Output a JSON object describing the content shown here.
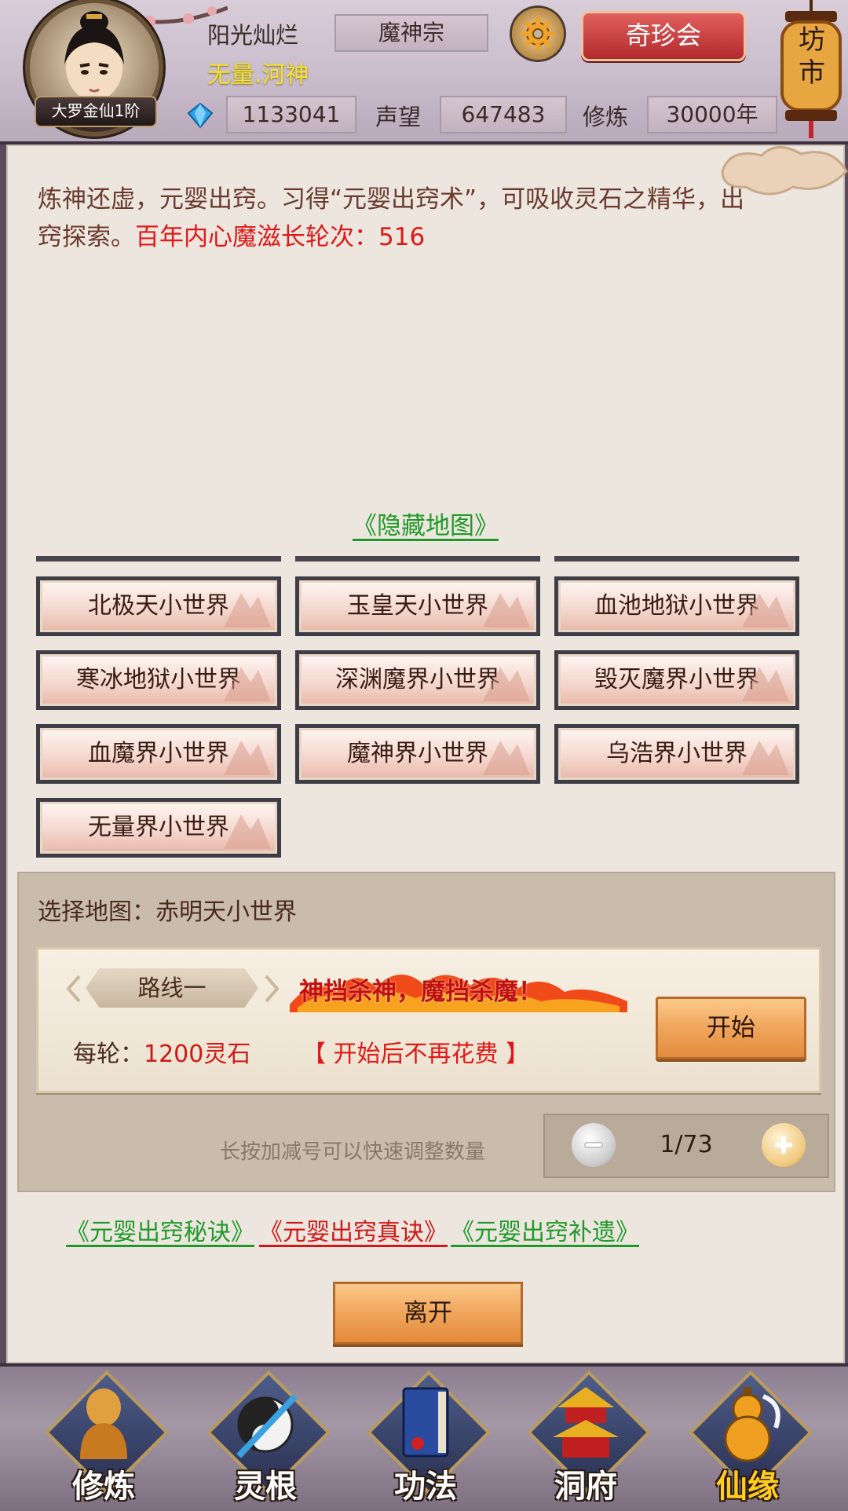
{
  "header": {
    "rank": "大罗金仙1阶",
    "player_name": "阳光灿烂",
    "player_title": "无量.河神",
    "sect": "魔神宗",
    "treasure_button": "奇珍会",
    "market_lantern": "坊市",
    "spirit_stones": "1133041",
    "reputation_label": "声望",
    "reputation": "647483",
    "cultivation_label": "修炼",
    "cultivation": "30000年",
    "icons": [
      "gear-icon",
      "gem-icon",
      "avatar-portrait"
    ]
  },
  "intro": {
    "text": "炼神还虚，元婴出窍。习得“元婴出窍术”，可吸收灵石之精华，出窍探索。",
    "highlight": "百年内心魔滋长轮次：516"
  },
  "hidden_map_link": "《隐藏地图》",
  "maps": [
    "北极天小世界",
    "玉皇天小世界",
    "血池地狱小世界",
    "寒冰地狱小世界",
    "深渊魔界小世界",
    "毁灭魔界小世界",
    "血魔界小世界",
    "魔神界小世界",
    "乌浩界小世界",
    "无量界小世界"
  ],
  "route": {
    "selected_map": "选择地图：赤明天小世界",
    "route_name": "路线一",
    "slogan": "神挡杀神，魔挡杀魔！",
    "cost_label": "每轮：",
    "cost_value": "1200灵石",
    "free_note": "【 开始后不再花费 】",
    "start_button": "开始",
    "hint": "长按加减号可以快速调整数量",
    "stepper_value": "1/73"
  },
  "links": [
    {
      "label": "《元婴出窍秘诀》",
      "color": "#1f9a2a"
    },
    {
      "label": "《元婴出窍真诀》",
      "color": "#d01818"
    },
    {
      "label": "《元婴出窍补遗》",
      "color": "#1f9a2a"
    }
  ],
  "leave_button": "离开",
  "bottom_nav": [
    {
      "label": "修炼",
      "icon": "monk-icon",
      "active": false
    },
    {
      "label": "灵根",
      "icon": "sword-icon",
      "active": false
    },
    {
      "label": "功法",
      "icon": "book-icon",
      "active": false
    },
    {
      "label": "洞府",
      "icon": "pagoda-icon",
      "active": false
    },
    {
      "label": "仙缘",
      "icon": "gourd-icon",
      "active": true
    }
  ]
}
